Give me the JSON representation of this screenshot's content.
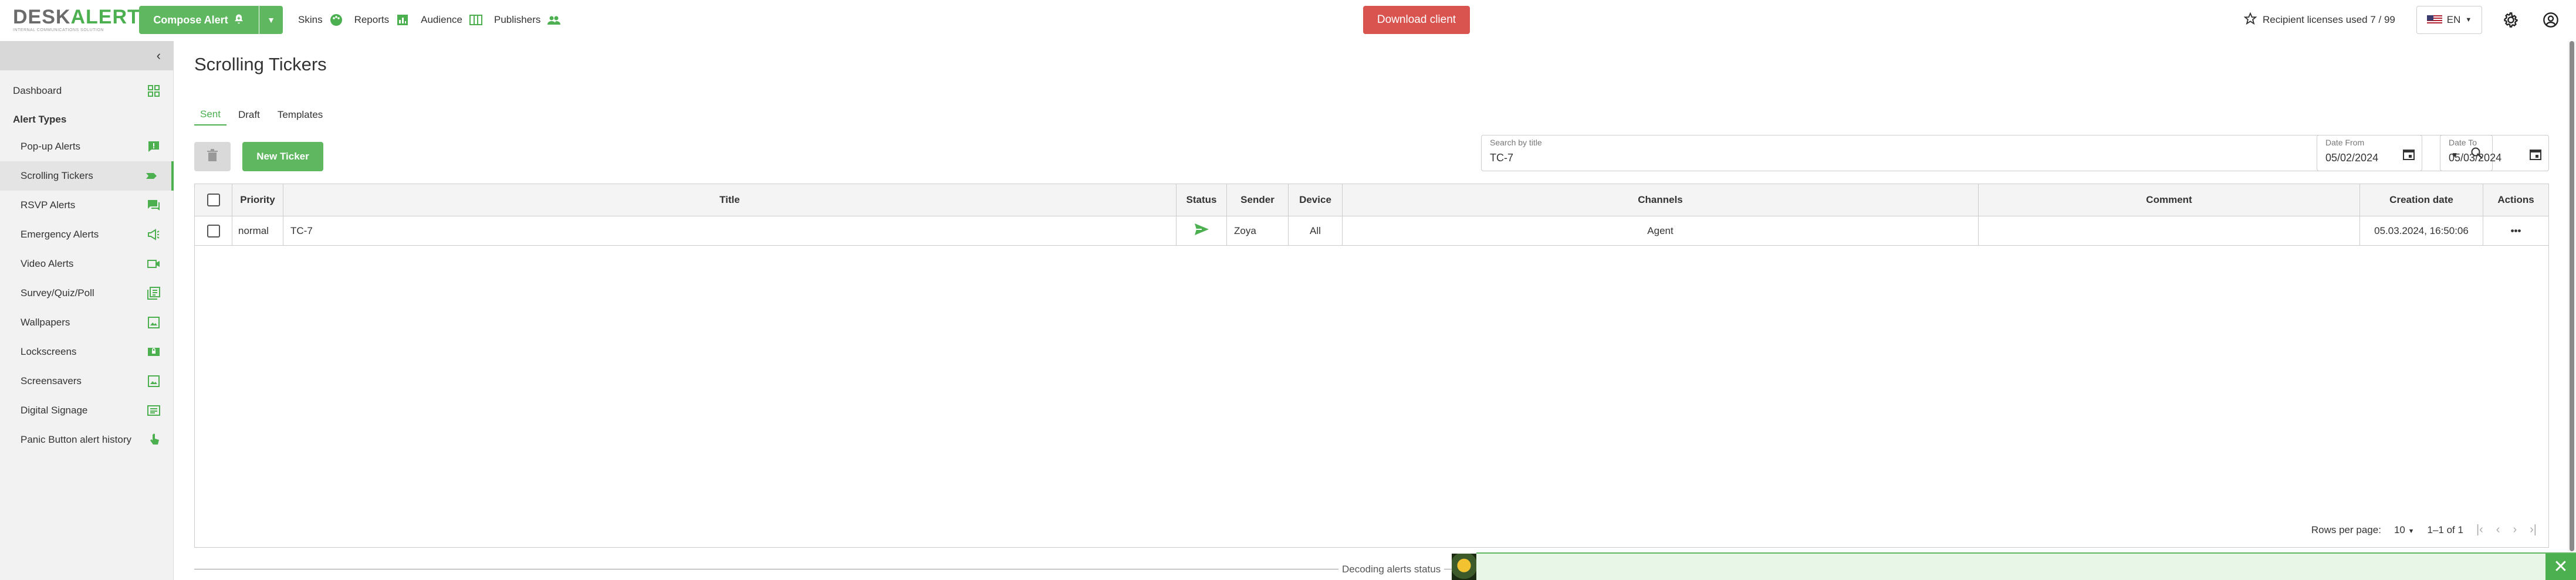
{
  "header": {
    "logo_main_a": "DESK",
    "logo_main_b": "ALERTS",
    "logo_sub": "INTERNAL COMMUNICATIONS SOLUTION",
    "compose_label": "Compose Alert",
    "nav": [
      {
        "label": "Skins",
        "icon": "palette-icon"
      },
      {
        "label": "Reports",
        "icon": "chart-icon"
      },
      {
        "label": "Audience",
        "icon": "audience-icon"
      },
      {
        "label": "Publishers",
        "icon": "people-icon"
      }
    ],
    "download_label": "Download client",
    "licenses_label": "Recipient licenses used 7 / 99",
    "lang": "EN"
  },
  "sidebar": {
    "dashboard": "Dashboard",
    "section": "Alert Types",
    "items": [
      {
        "label": "Pop-up Alerts",
        "icon": "popup-alert-icon"
      },
      {
        "label": "Scrolling Tickers",
        "icon": "ticker-icon"
      },
      {
        "label": "RSVP Alerts",
        "icon": "rsvp-icon"
      },
      {
        "label": "Emergency Alerts",
        "icon": "megaphone-icon"
      },
      {
        "label": "Video Alerts",
        "icon": "video-icon"
      },
      {
        "label": "Survey/Quiz/Poll",
        "icon": "survey-icon"
      },
      {
        "label": "Wallpapers",
        "icon": "wallpaper-icon"
      },
      {
        "label": "Lockscreens",
        "icon": "lockscreen-icon"
      },
      {
        "label": "Screensavers",
        "icon": "screensaver-icon"
      },
      {
        "label": "Digital Signage",
        "icon": "signage-icon"
      },
      {
        "label": "Panic Button alert history",
        "icon": "panic-button-icon"
      }
    ]
  },
  "main": {
    "title": "Scrolling Tickers",
    "tabs": [
      "Sent",
      "Draft",
      "Templates"
    ],
    "new_ticker": "New Ticker",
    "search": {
      "label": "Search by title",
      "value": "TC-7"
    },
    "date_from": {
      "label": "Date From",
      "value": "05/02/2024"
    },
    "date_to": {
      "label": "Date To",
      "value": "05/03/2024"
    },
    "table": {
      "headers": [
        "Priority",
        "Title",
        "Status",
        "Sender",
        "Device",
        "Channels",
        "Comment",
        "Creation date",
        "Actions"
      ],
      "rows": [
        {
          "priority": "normal",
          "title": "TC-7",
          "status": "sent-icon",
          "sender": "Zoya",
          "device": "All",
          "channels": "Agent",
          "comment": "",
          "creation_date": "05.03.2024, 16:50:06",
          "actions": "•••"
        }
      ]
    },
    "pagination": {
      "rows_label": "Rows per page:",
      "rows_value": "10",
      "range": "1–1 of 1"
    },
    "decode_label": "Decoding alerts status"
  },
  "colors": {
    "accent": "#4caf50",
    "danger": "#d9534f"
  }
}
